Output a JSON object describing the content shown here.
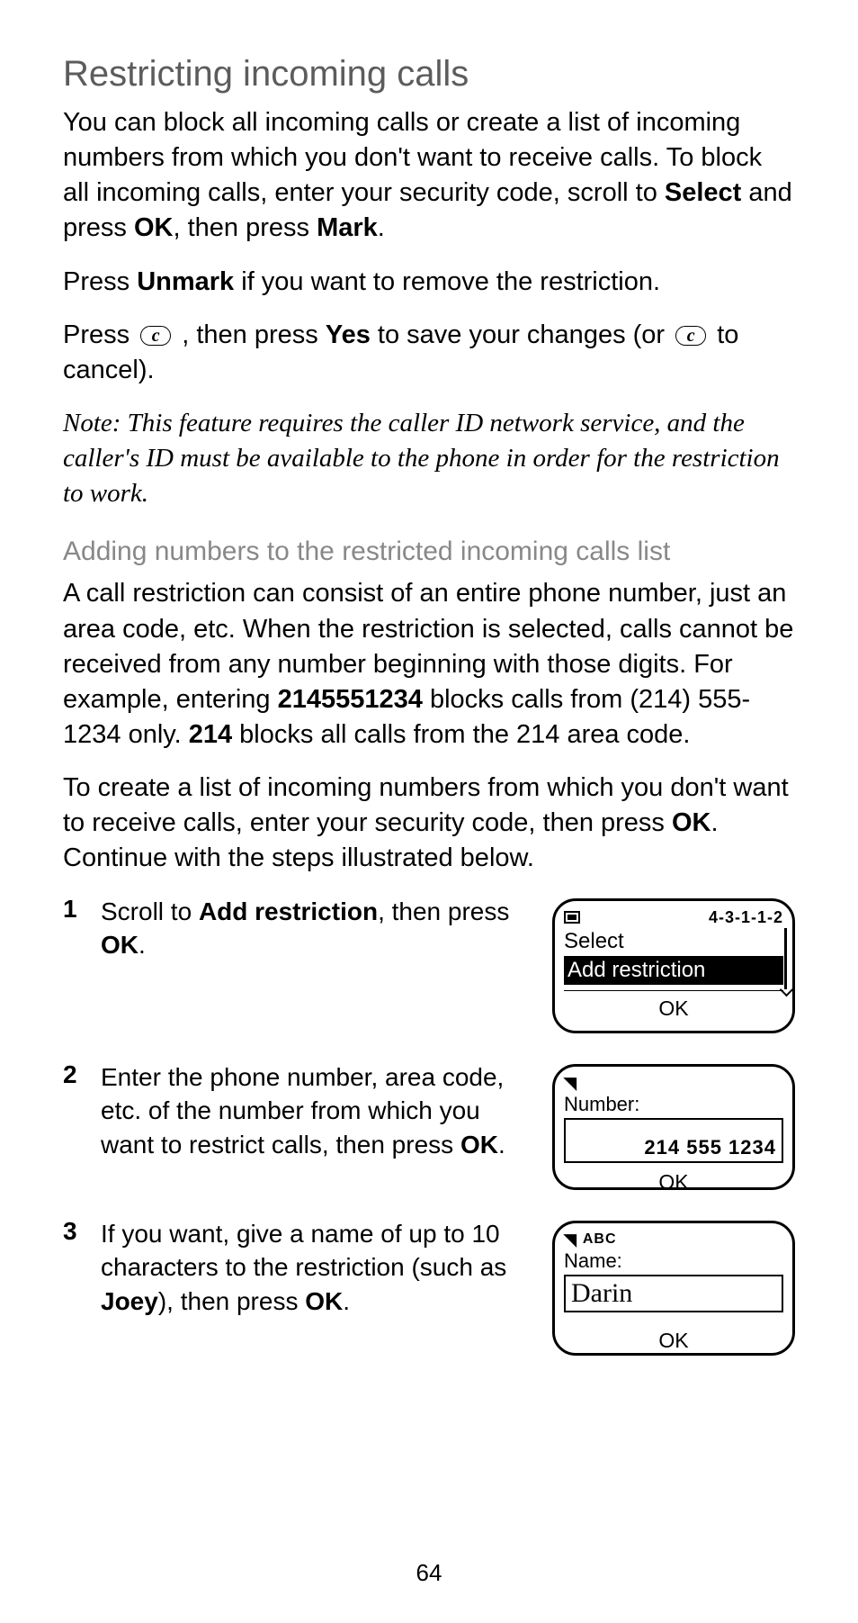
{
  "heading": "Restricting incoming calls",
  "para1_a": "You can block all incoming calls or create a list of incoming numbers from which you don't want to receive calls. To block all incoming calls, enter your security code, scroll to ",
  "para1_select": "Select",
  "para1_b": " and press ",
  "para1_ok": "OK",
  "para1_c": ", then press ",
  "para1_mark": "Mark",
  "para1_d": ".",
  "para2_a": "Press ",
  "para2_unmark": "Unmark",
  "para2_b": " if you want to remove the restriction.",
  "para3_a": "Press ",
  "para3_b": " , then press ",
  "para3_yes": "Yes",
  "para3_c": " to save your changes (or ",
  "para3_d": " to cancel).",
  "note": "Note: This feature requires the caller ID network service, and the caller's ID must be available to the phone in order for the restriction to work.",
  "subheading": "Adding numbers to the restricted incoming calls list",
  "para4_a": "A call restriction can consist of an entire phone number, just an area code, etc. When the restriction is selected, calls cannot be received from any number beginning with those digits. For example, entering ",
  "para4_num1": "2145551234",
  "para4_b": " blocks calls from (214) 555-1234 only. ",
  "para4_num2": "214",
  "para4_c": " blocks all calls from the 214 area code.",
  "para5_a": "To create a list of incoming numbers from which you don't want to receive calls, enter your security code, then press ",
  "para5_ok": "OK",
  "para5_b": ". Continue with the steps illustrated below.",
  "steps": {
    "s1": {
      "num": "1",
      "text_a": " Scroll to ",
      "text_bold": "Add restriction",
      "text_b": ", then press ",
      "text_ok": "OK",
      "text_c": "."
    },
    "s2": {
      "num": "2",
      "text_a": "Enter the phone number, area code, etc. of the number from which you want to restrict calls, then press ",
      "text_ok": "OK",
      "text_b": "."
    },
    "s3": {
      "num": "3",
      "text_a": "If you want, give a name of up to 10 characters to the restriction (such as ",
      "text_bold": "Joey",
      "text_b": "), then press ",
      "text_ok": "OK",
      "text_c": "."
    }
  },
  "screens": {
    "s1": {
      "menucode": "4-3-1-1-2",
      "select_label": "Select",
      "highlight": "Add restriction",
      "ok": "OK"
    },
    "s2": {
      "label": "Number:",
      "value": "214 555 1234",
      "ok": "OK"
    },
    "s3": {
      "top": "ABC",
      "label": "Name:",
      "value": "Darin",
      "ok": "OK"
    }
  },
  "page_number": "64",
  "c_key_glyph": "c"
}
